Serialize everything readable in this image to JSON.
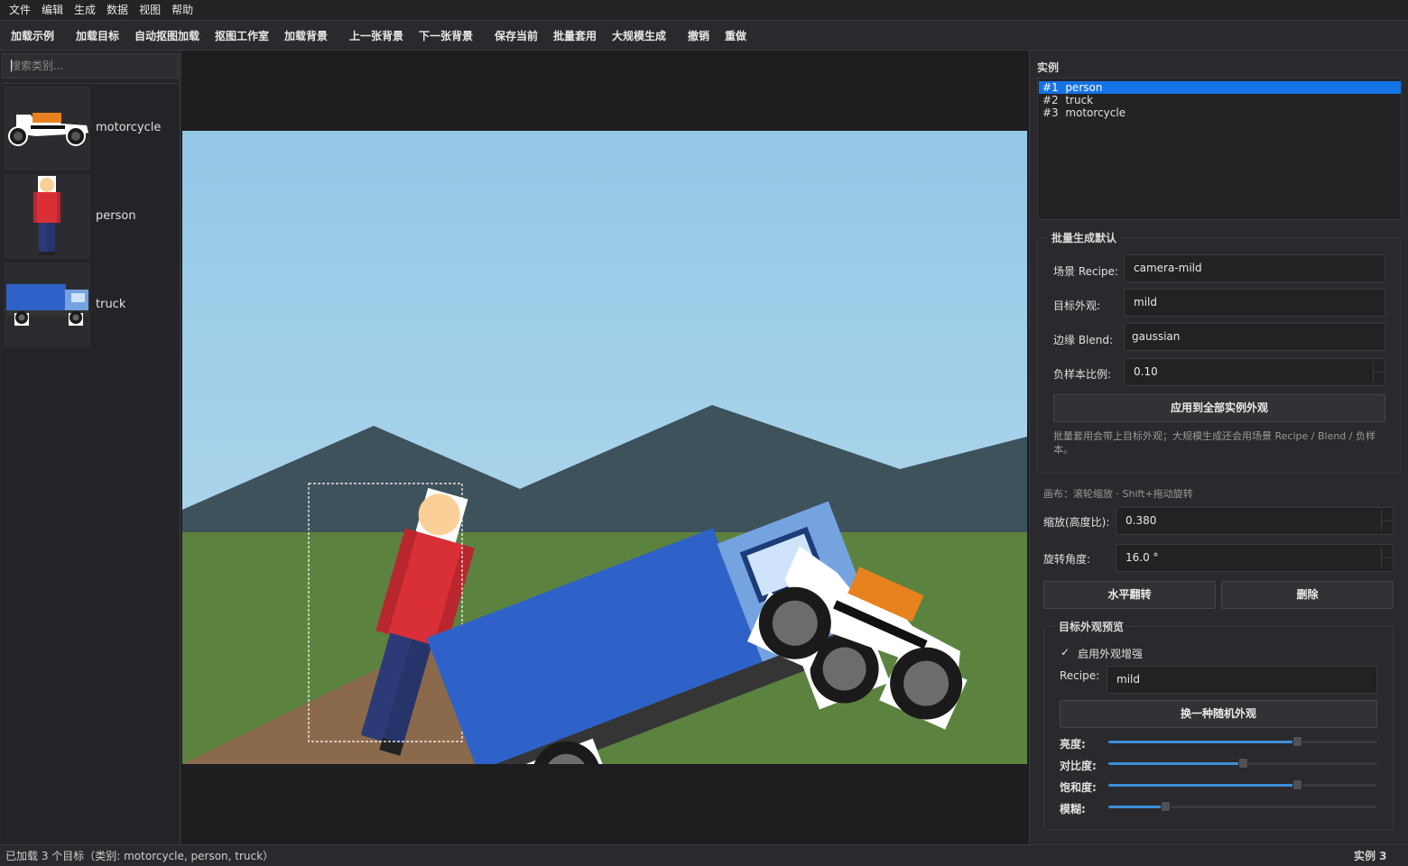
{
  "menu": [
    "文件",
    "编辑",
    "生成",
    "数据",
    "视图",
    "帮助"
  ],
  "toolbar": [
    "加载示例",
    "加载目标",
    "自动抠图加载",
    "抠图工作室",
    "加载背景",
    "上一张背景",
    "下一张背景",
    "保存当前",
    "批量套用",
    "大规模生成",
    "撤销",
    "重做"
  ],
  "left": {
    "search_placeholder": "搜索类别...",
    "categories": [
      {
        "label": "motorcycle",
        "icon": "motorcycle-thumbnail"
      },
      {
        "label": "person",
        "icon": "person-thumbnail"
      },
      {
        "label": "truck",
        "icon": "truck-thumbnail"
      }
    ]
  },
  "scene": {
    "colors": {
      "sky": "#93c7e6",
      "mountain": "#3d525b",
      "grass": "#5c8240",
      "path": "#8b6a4c"
    },
    "objects": [
      "person",
      "truck",
      "motorcycle"
    ]
  },
  "right": {
    "instances_title": "实例",
    "instances": [
      {
        "label": "#1  person",
        "selected": true
      },
      {
        "label": "#2  truck",
        "selected": false
      },
      {
        "label": "#3  motorcycle",
        "selected": false
      }
    ],
    "batch": {
      "title": "批量生成默认",
      "scene_recipe_label": "场景 Recipe:",
      "scene_recipe": "camera-mild",
      "target_look_label": "目标外观:",
      "target_look": "mild",
      "edge_blend_label": "边缘 Blend:",
      "edge_blend": "gaussian",
      "neg_ratio_label": "负样本比例:",
      "neg_ratio": "0.10",
      "apply_button": "应用到全部实例外观",
      "note": "批量套用会带上目标外观；大规模生成还会用场景 Recipe / Blend / 负样本。"
    },
    "canvas_hint": "画布：滚轮缩放 · Shift+拖动旋转",
    "scale_label": "缩放(高度比):",
    "scale_value": "0.380",
    "rotation_label": "旋转角度:",
    "rotation_value": "16.0 °",
    "flip_button": "水平翻转",
    "delete_button": "删除",
    "preview": {
      "title": "目标外观预览",
      "enable_label": "启用外观增强",
      "enabled": true,
      "recipe_label": "Recipe:",
      "recipe_value": "mild",
      "random_button": "换一种随机外观",
      "sliders": [
        {
          "label": "亮度:",
          "value": 0.7
        },
        {
          "label": "对比度:",
          "value": 0.5
        },
        {
          "label": "饱和度:",
          "value": 0.7
        },
        {
          "label": "模糊:",
          "value": 0.21
        }
      ]
    }
  },
  "status": {
    "left": "已加载 3 个目标（类别: motorcycle, person, truck）",
    "right": "实例 3"
  }
}
